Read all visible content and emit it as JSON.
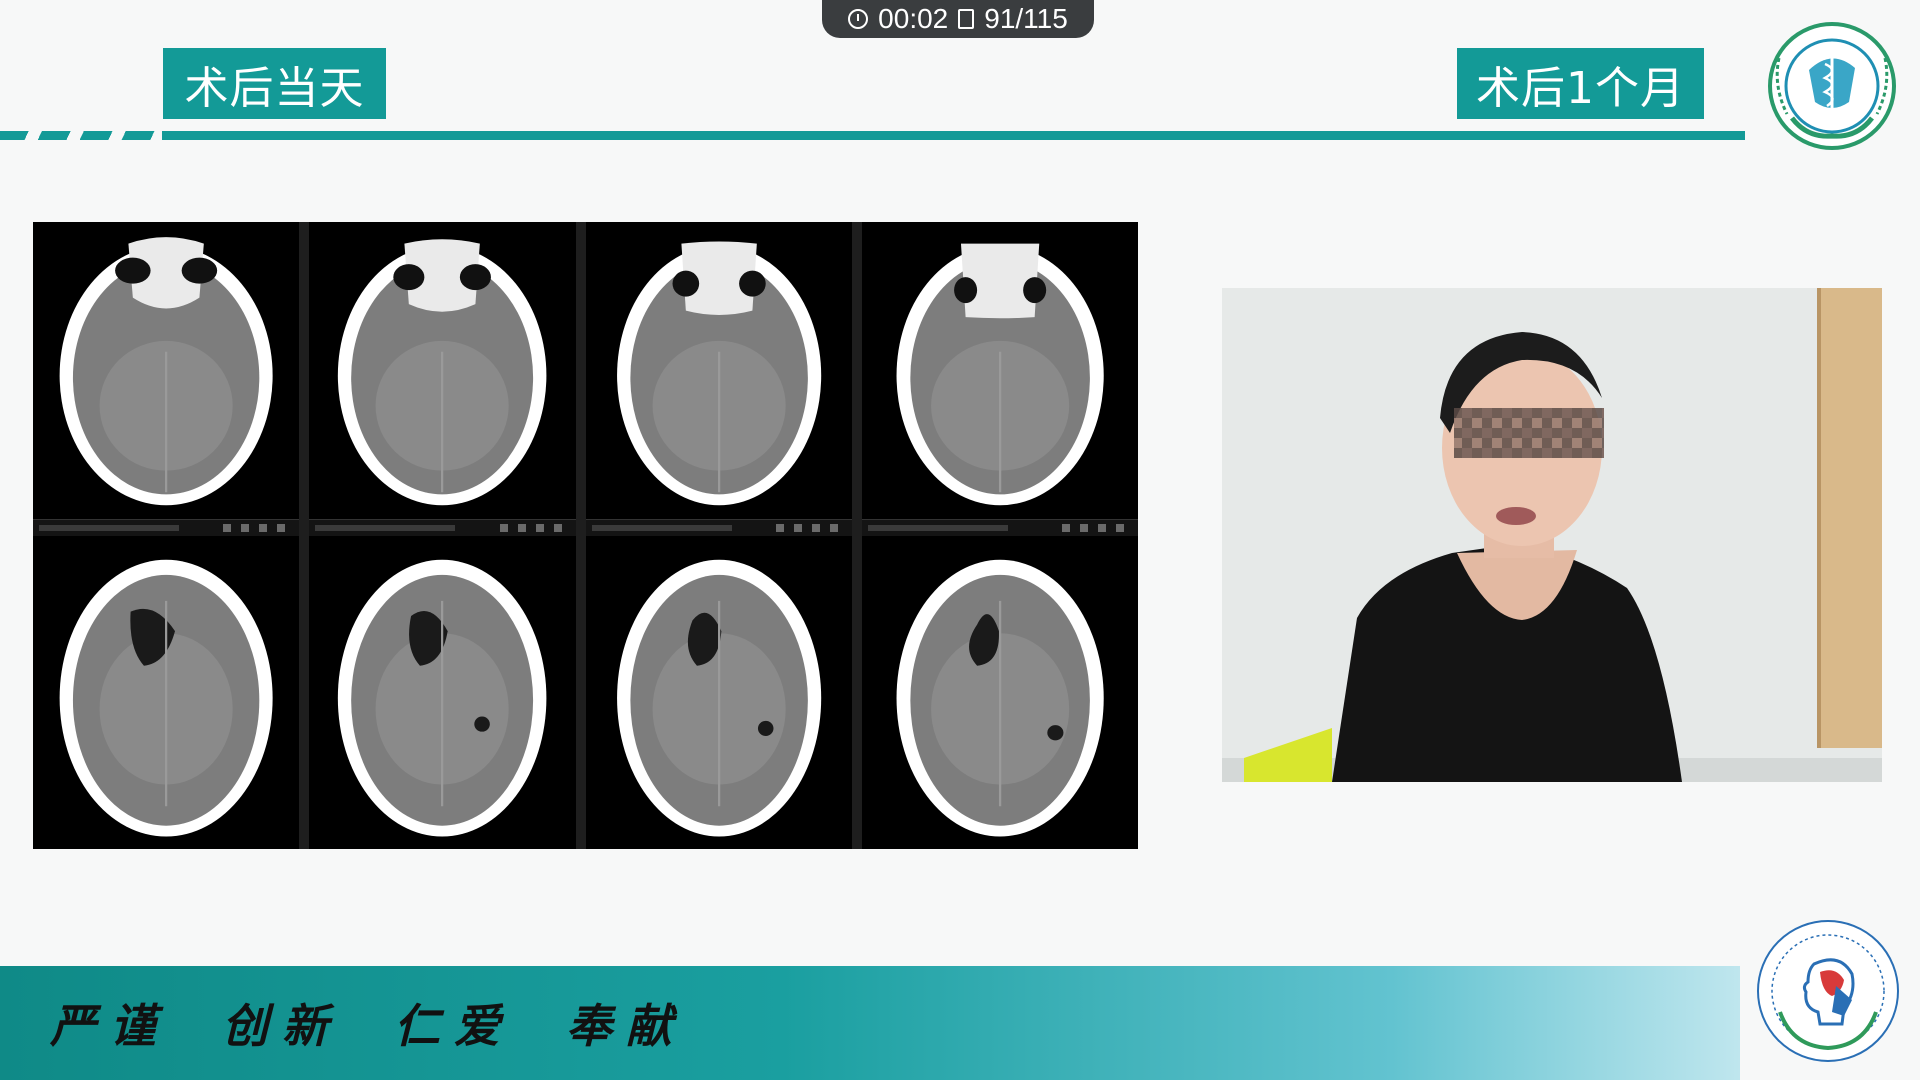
{
  "player": {
    "elapsed": "00:02",
    "slide": "91/115"
  },
  "labels": {
    "left": "术后当天",
    "right": "术后1个月"
  },
  "ct": {
    "slices": 8
  },
  "banner": {
    "motto": [
      "严谨",
      "创新",
      "仁爱",
      "奉献"
    ]
  },
  "icons": {
    "clock": "clock-icon",
    "slide": "slide-counter-icon",
    "logo_top": "hospital-emblem",
    "logo_bottom": "center-emblem"
  },
  "colors": {
    "accent": "#139a97",
    "banner_end": "#bfe6ee"
  }
}
